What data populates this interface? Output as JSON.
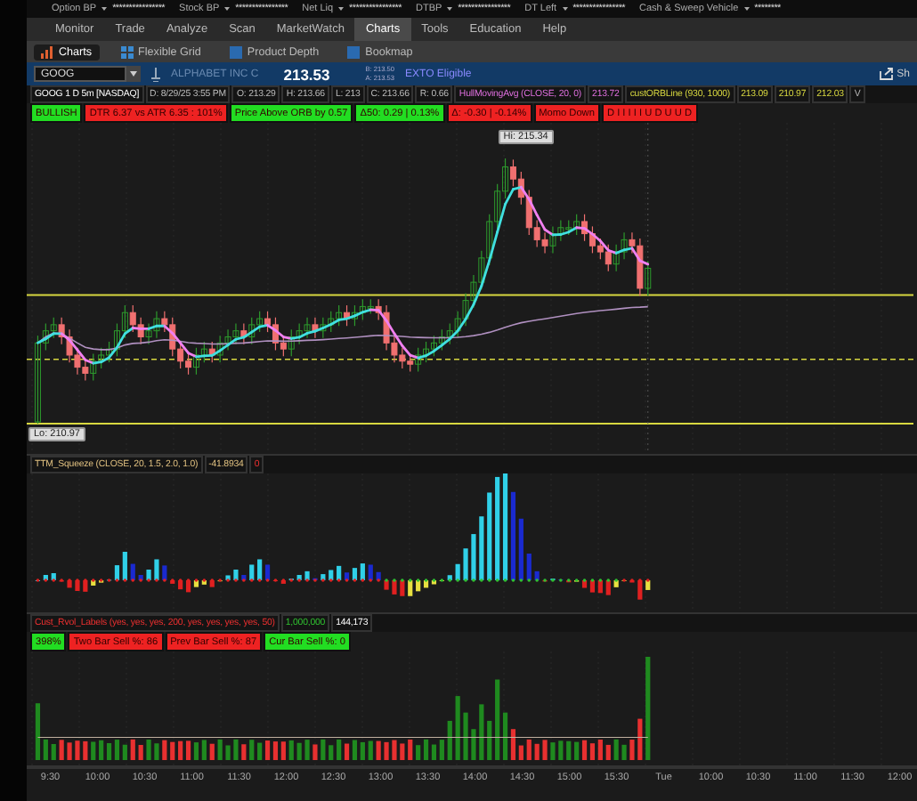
{
  "account_bar": [
    {
      "label": "Option BP",
      "value": "****************"
    },
    {
      "label": "Stock BP",
      "value": "****************"
    },
    {
      "label": "Net Liq",
      "value": "****************"
    },
    {
      "label": "DTBP",
      "value": "****************"
    },
    {
      "label": "DT Left",
      "value": "****************"
    },
    {
      "label": "Cash & Sweep Vehicle",
      "value": "********"
    }
  ],
  "menu": [
    {
      "label": "Monitor",
      "selected": false
    },
    {
      "label": "Trade",
      "selected": false
    },
    {
      "label": "Analyze",
      "selected": false
    },
    {
      "label": "Scan",
      "selected": false
    },
    {
      "label": "MarketWatch",
      "selected": false
    },
    {
      "label": "Charts",
      "selected": true
    },
    {
      "label": "Tools",
      "selected": false
    },
    {
      "label": "Education",
      "selected": false
    },
    {
      "label": "Help",
      "selected": false
    }
  ],
  "subtabs": [
    {
      "label": "Charts",
      "selected": true,
      "kind": "chart"
    },
    {
      "label": "Flexible Grid",
      "selected": false,
      "kind": "grid"
    },
    {
      "label": "Product Depth",
      "selected": false,
      "kind": "square"
    },
    {
      "label": "Bookmap",
      "selected": false,
      "kind": "square"
    }
  ],
  "symbol_bar": {
    "symbol": "GOOG",
    "company": "ALPHABET INC C",
    "last": "213.53",
    "bid": "B: 213.50",
    "ask": "A: 213.53",
    "eligibility": "EXTO Eligible",
    "share_label": "Sh"
  },
  "study_header": [
    {
      "text": "GOOG 1 D 5m [NASDAQ]",
      "kind": "title"
    },
    {
      "text": "D: 8/29/25 3:55 PM",
      "kind": "plain"
    },
    {
      "text": "O: 213.29",
      "kind": "plain"
    },
    {
      "text": "H: 213.66",
      "kind": "plain"
    },
    {
      "text": "L: 213",
      "kind": "plain"
    },
    {
      "text": "C: 213.66",
      "kind": "plain"
    },
    {
      "text": "R: 0.66",
      "kind": "plain"
    },
    {
      "text": "HullMovingAvg (CLOSE, 20, 0)",
      "kind": "hull"
    },
    {
      "text": "213.72",
      "kind": "hull"
    },
    {
      "text": "custORBLine (930, 1000)",
      "kind": "orb"
    },
    {
      "text": "213.09",
      "kind": "orb"
    },
    {
      "text": "210.97",
      "kind": "orb"
    },
    {
      "text": "212.03",
      "kind": "orb"
    },
    {
      "text": "V",
      "kind": "plain"
    }
  ],
  "labels": [
    {
      "text": "BULLISH",
      "color": "#22dd22"
    },
    {
      "text": "DTR 6.37 vs ATR 6.35 : 101%",
      "color": "#ee2222"
    },
    {
      "text": "Price Above ORB by 0.57",
      "color": "#22dd22"
    },
    {
      "text": "Δ50: 0.29 | 0.13%",
      "color": "#22dd22"
    },
    {
      "text": "Δ: -0.30 | -0.14%",
      "color": "#ee2222"
    },
    {
      "text": "Momo Down",
      "color": "#ee2222"
    },
    {
      "text": "D I I I I I U D U U D",
      "color": "#ee2222"
    }
  ],
  "price_chart": {
    "high_label": "Hi: 215.34",
    "low_label": "Lo: 210.97"
  },
  "squeeze_header": [
    {
      "text": "TTM_Squeeze (CLOSE, 20, 1.5, 2.0, 1.0)",
      "kind": "squeeze"
    },
    {
      "text": "-41.8934",
      "kind": "squeeze"
    },
    {
      "text": "0",
      "kind": "alert"
    }
  ],
  "volume_header": [
    {
      "text": "Cust_Rvol_Labels (yes, yes, yes, 200, yes, yes, yes, yes, 50)",
      "kind": "alert"
    },
    {
      "text": "1,000,000",
      "kind": "good"
    },
    {
      "text": "144,173",
      "kind": "title"
    }
  ],
  "volume_labels": [
    {
      "text": "398%",
      "color": "#22dd22"
    },
    {
      "text": "Two Bar Sell %: 86",
      "color": "#ee2222"
    },
    {
      "text": "Prev Bar Sell %: 87",
      "color": "#ee2222"
    },
    {
      "text": "Cur Bar Sell %: 0",
      "color": "#22dd22"
    }
  ],
  "time_axis": [
    "9:30",
    "10:00",
    "10:30",
    "11:00",
    "11:30",
    "12:00",
    "12:30",
    "13:00",
    "13:30",
    "14:00",
    "14:30",
    "15:00",
    "15:30",
    "Tue",
    "10:00",
    "10:30",
    "11:00",
    "11:30",
    "12:00"
  ]
}
